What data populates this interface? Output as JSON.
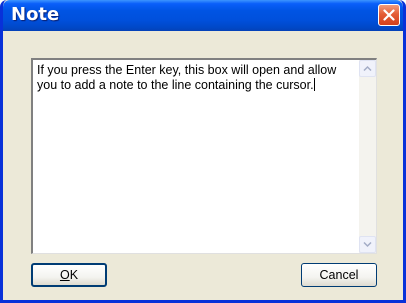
{
  "window": {
    "title": "Note",
    "close_icon": "close-icon"
  },
  "note": {
    "text": "If you press the Enter key, this box will open and allow you to add a note to the line containing the cursor."
  },
  "buttons": {
    "ok_label": "OK",
    "cancel_label": "Cancel"
  },
  "colors": {
    "titlebar": "#0054e3",
    "close": "#e45d36",
    "dialog_bg": "#ece9d8"
  }
}
